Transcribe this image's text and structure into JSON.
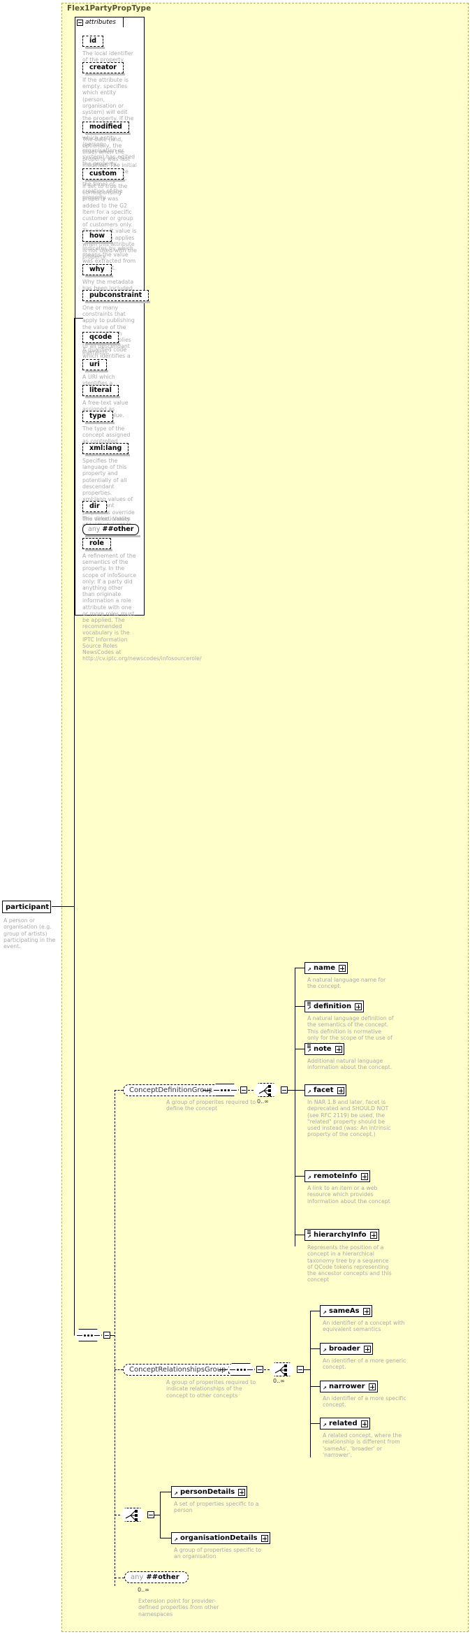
{
  "diagram": {
    "type_title": "Flex1PartyPropType",
    "attributes_label": "attributes",
    "root_element": {
      "name": "participant",
      "description": "A person or organisation (e.g. group of artists) participating in the event."
    },
    "attributes": [
      {
        "name": "id",
        "description": "The local identifier of the property."
      },
      {
        "name": "creator",
        "description": "If the attribute is empty, specifies which entity (person, organisation or system) will edit the property. If the attribute is non-empty, specifies which entity (person, organisation or system) has edited the property."
      },
      {
        "name": "modified",
        "description": "The date (and, optionally, the time) when the property was last modified. The initial value is the date (and, optionally, the time) of creation of the property."
      },
      {
        "name": "custom",
        "description": "If set to true the corresponding property was added to the G2 Item for a specific customer or group of customers only. The default value is false which applies when this attribute is not used with the property."
      },
      {
        "name": "how",
        "description": "Indicates by which means the value was extracted from the content."
      },
      {
        "name": "why",
        "description": "Why the metadata has been included."
      },
      {
        "name": "pubconstraint",
        "description": "One or many constraints that apply to publishing the value of the property. Each constraint applies to all descendant elements."
      },
      {
        "name": "qcode",
        "description": "A qualified code which identifies a concept."
      },
      {
        "name": "uri",
        "description": "A URI which identifies a concept."
      },
      {
        "name": "literal",
        "description": "A free-text value assigned as property value."
      },
      {
        "name": "type",
        "description": "The type of the concept assigned as controlled property value."
      },
      {
        "name": "xml:lang",
        "description": "Specifies the language of this property and potentially of all descendant properties. xml:lang values of descendant properties override this value. Values are determined by Internet BCP 47."
      },
      {
        "name": "dir",
        "description": "The directionality of textual content."
      },
      {
        "name": "any ##other",
        "wildcard": true,
        "any_word": "any",
        "ns_word": "##other",
        "description": ""
      },
      {
        "name": "role",
        "description": "A refinement of the semantics of the property. In the scope of infoSource only: If a party did anything other than originate information a role attribute with one or more roles must be applied. The recommended vocabulary is the IPTC Information Source Roles NewsCodes at http://cv.iptc.org/newscodes/infosourcerole/"
      }
    ],
    "groups": [
      {
        "id": "concept-definition-group",
        "name": "ConceptDefinitionGroup",
        "description": "A group of properites required to define the concept",
        "occurs": "0..∞",
        "elements": [
          {
            "name": "name",
            "description": "A natural language name for the concept.",
            "has_lead": false
          },
          {
            "name": "definition",
            "description": "A natural language definition of the semantics of the concept. This definition is normative only for the scope of the use of this concept.",
            "has_lead": true
          },
          {
            "name": "note",
            "description": "Additional natural language information about the concept.",
            "has_lead": true
          },
          {
            "name": "facet",
            "description": "In NAR 1.8 and later, facet is deprecated and SHOULD NOT (see RFC 2119) be used, the \"related\" property should be used instead (was: An intrinsic property of the concept.)",
            "has_lead": false
          },
          {
            "name": "remoteInfo",
            "description": "A link to an item or a web resource which provides information about the concept",
            "has_lead": false
          },
          {
            "name": "hierarchyInfo",
            "description": "Represents the position of a concept in a hierarchical taxonomy tree by a sequence of QCode tokens representing the ancestor concepts and this concept",
            "has_lead": true
          }
        ]
      },
      {
        "id": "concept-relationships-group",
        "name": "ConceptRelationshipsGroup",
        "description": "A group of properites required to indicate relationships of the concept to other concepts",
        "occurs": "0..∞",
        "elements": [
          {
            "name": "sameAs",
            "description": "An identifier of a concept with equivalent semantics",
            "has_lead": false
          },
          {
            "name": "broader",
            "description": "An identifier of a more generic concept.",
            "has_lead": false
          },
          {
            "name": "narrower",
            "description": "An identifier of a more specific concept.",
            "has_lead": false
          },
          {
            "name": "related",
            "description": "A related concept, where the relationship is different from 'sameAs', 'broader' or 'narrower'.",
            "has_lead": false
          }
        ]
      }
    ],
    "details_choice": {
      "elements": [
        {
          "name": "personDetails",
          "description": "A set of properties specific to a person",
          "has_lead": false
        },
        {
          "name": "organisationDetails",
          "description": "A group of properties specific to an organisation",
          "has_lead": false
        }
      ]
    },
    "extension": {
      "any_word": "any",
      "ns_word": "##other",
      "occurs": "0..∞",
      "description": "Extension point for provider-defined properties from other namespaces"
    },
    "colors": {
      "background": "#ffffcc",
      "page": "#ffffff",
      "description_text": "#a9a9a9",
      "line": "#000000",
      "shadow": "#c0c0c0",
      "title_text": "#555533"
    }
  }
}
